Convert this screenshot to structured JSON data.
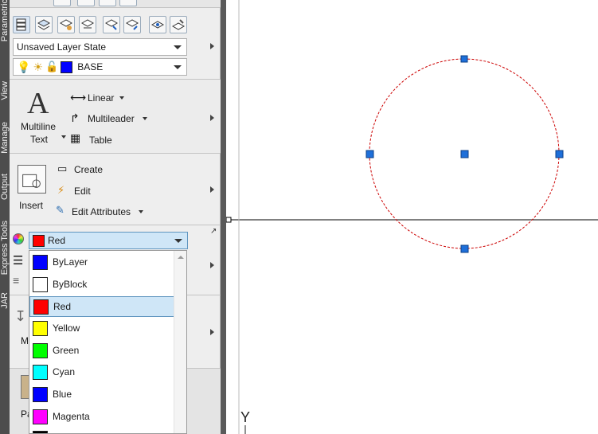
{
  "vertical_tabs": [
    "Parametric",
    "View",
    "Manage",
    "Output",
    "Express Tools",
    "JAR"
  ],
  "layers": {
    "layer_state": "Unsaved Layer State",
    "current_layer": "BASE",
    "current_layer_color": "#0000ff"
  },
  "annotation": {
    "multiline_text_line1": "Multiline",
    "multiline_text_line2": "Text",
    "big_letter": "A",
    "linear": "Linear",
    "multileader": "Multileader",
    "table": "Table"
  },
  "block": {
    "insert": "Insert",
    "create": "Create",
    "edit": "Edit",
    "edit_attributes": "Edit Attributes"
  },
  "properties": {
    "color_combo_value": "Red",
    "color_combo_swatch": "#ff0000",
    "color_options": [
      {
        "label": "ByLayer",
        "color": "#0000ff"
      },
      {
        "label": "ByBlock",
        "color": "#ffffff"
      },
      {
        "label": "Red",
        "color": "#ff0000",
        "selected": true
      },
      {
        "label": "Yellow",
        "color": "#ffff00"
      },
      {
        "label": "Green",
        "color": "#00ff00"
      },
      {
        "label": "Cyan",
        "color": "#00ffff"
      },
      {
        "label": "Blue",
        "color": "#0000ff"
      },
      {
        "label": "Magenta",
        "color": "#ff00ff"
      },
      {
        "label": "",
        "color": "#000000"
      }
    ]
  },
  "partial_labels": {
    "measure": "M",
    "paste": "Pa"
  },
  "canvas": {
    "ucs_y_label": "Y",
    "circle_linetype_color": "#cc0000",
    "grip_color": "#1e6fd9"
  }
}
